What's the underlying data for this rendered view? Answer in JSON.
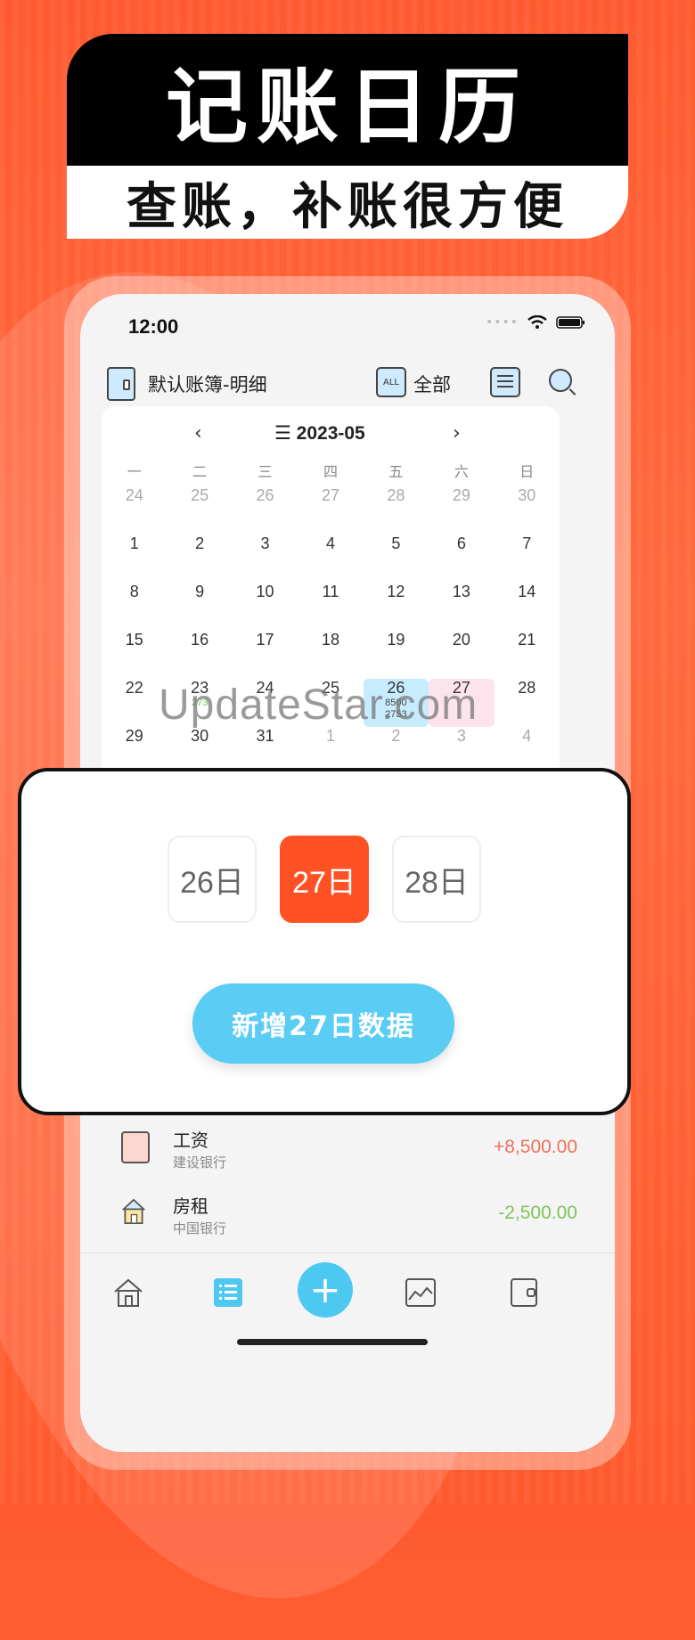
{
  "banner": {
    "title": "记账日历",
    "subtitle": "查账，补账很方便"
  },
  "status_bar": {
    "time": "12:00"
  },
  "top_bar": {
    "book_title": "默认账簿-明细",
    "all_icon_text": "ALL",
    "all_label": "全部"
  },
  "calendar": {
    "prev": "‹",
    "next": "›",
    "menu_glyph": "☰",
    "month": "2023-05",
    "weekdays": [
      "一",
      "二",
      "三",
      "四",
      "五",
      "六",
      "日"
    ],
    "days": [
      {
        "d": "24",
        "dim": true
      },
      {
        "d": "25",
        "dim": true
      },
      {
        "d": "26",
        "dim": true
      },
      {
        "d": "27",
        "dim": true
      },
      {
        "d": "28",
        "dim": true
      },
      {
        "d": "29",
        "dim": true
      },
      {
        "d": "30",
        "dim": true
      },
      {
        "d": "1"
      },
      {
        "d": "2"
      },
      {
        "d": "3"
      },
      {
        "d": "4"
      },
      {
        "d": "5"
      },
      {
        "d": "6"
      },
      {
        "d": "7"
      },
      {
        "d": "8"
      },
      {
        "d": "9"
      },
      {
        "d": "10"
      },
      {
        "d": "11"
      },
      {
        "d": "12"
      },
      {
        "d": "13"
      },
      {
        "d": "14"
      },
      {
        "d": "15"
      },
      {
        "d": "16"
      },
      {
        "d": "17"
      },
      {
        "d": "18"
      },
      {
        "d": "19"
      },
      {
        "d": "20"
      },
      {
        "d": "21"
      },
      {
        "d": "22"
      },
      {
        "d": "23",
        "amt": "273",
        "amt_color": "green"
      },
      {
        "d": "24"
      },
      {
        "d": "25"
      },
      {
        "d": "26",
        "amt": "8500",
        "amt2": "2753",
        "amt_color": "dark",
        "hl": "blue"
      },
      {
        "d": "27",
        "hl": "pink"
      },
      {
        "d": "28"
      },
      {
        "d": "29"
      },
      {
        "d": "30"
      },
      {
        "d": "31"
      },
      {
        "d": "1",
        "dim": true
      },
      {
        "d": "2",
        "dim": true
      },
      {
        "d": "3",
        "dim": true
      },
      {
        "d": "4",
        "dim": true
      }
    ]
  },
  "watermark": "UpdateStar.com",
  "day_picker": {
    "days": [
      "26日",
      "27日",
      "28日"
    ],
    "selected_index": 1,
    "add_button": "新增27日数据"
  },
  "entries": [
    {
      "title": "工资",
      "account": "建设银行",
      "amount": "+8,500.00",
      "type": "income",
      "icon": "wallet-icon"
    },
    {
      "title": "房租",
      "account": "中国银行",
      "amount": "-2,500.00",
      "type": "expense",
      "icon": "house-icon"
    }
  ],
  "tab_bar": {
    "plus": "+",
    "tabs": [
      "home-icon",
      "list-icon",
      "add-icon",
      "chart-icon",
      "wallet-icon"
    ]
  },
  "colors": {
    "accent": "#ff5124",
    "add_button": "#5bcdf5",
    "income": "#f0705a",
    "expense": "#7fc25a"
  }
}
